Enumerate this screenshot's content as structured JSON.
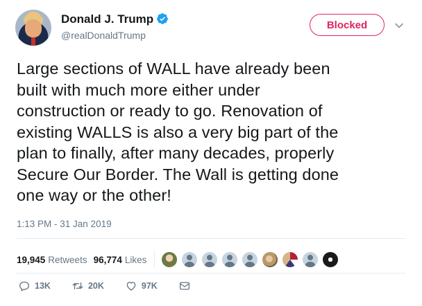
{
  "user": {
    "display_name": "Donald J. Trump",
    "handle": "@realDonaldTrump",
    "verified": true,
    "follow_button_label": "Blocked"
  },
  "tweet": {
    "lines": [
      "Large sections of WALL have already been",
      "built with much more either under",
      "construction or ready to go. Renovation of",
      "existing WALLS is also a very big part of the",
      "plan to finally, after many decades, properly",
      "Secure Our Border. The Wall is getting done",
      "one way or the other!"
    ],
    "timestamp": "1:13 PM - 31 Jan 2019"
  },
  "stats": {
    "retweets_count": "19,945",
    "retweets_label": "Retweets",
    "likes_count": "96,774",
    "likes_label": "Likes"
  },
  "actions": {
    "reply_count": "13K",
    "retweet_count": "20K",
    "like_count": "97K"
  },
  "likers": [
    "photo1",
    "default",
    "default",
    "default",
    "default",
    "photo2",
    "photo3",
    "default",
    "photo5"
  ],
  "colors": {
    "blocked": "#e0245e",
    "verified": "#1da1f2",
    "secondary_text": "#657786",
    "divider": "#e6ecf0"
  },
  "icons": {
    "verified": "verified-badge-icon",
    "menu": "chevron-down-icon",
    "reply": "reply-icon",
    "retweet": "retweet-icon",
    "like": "heart-icon",
    "dm": "envelope-icon"
  }
}
